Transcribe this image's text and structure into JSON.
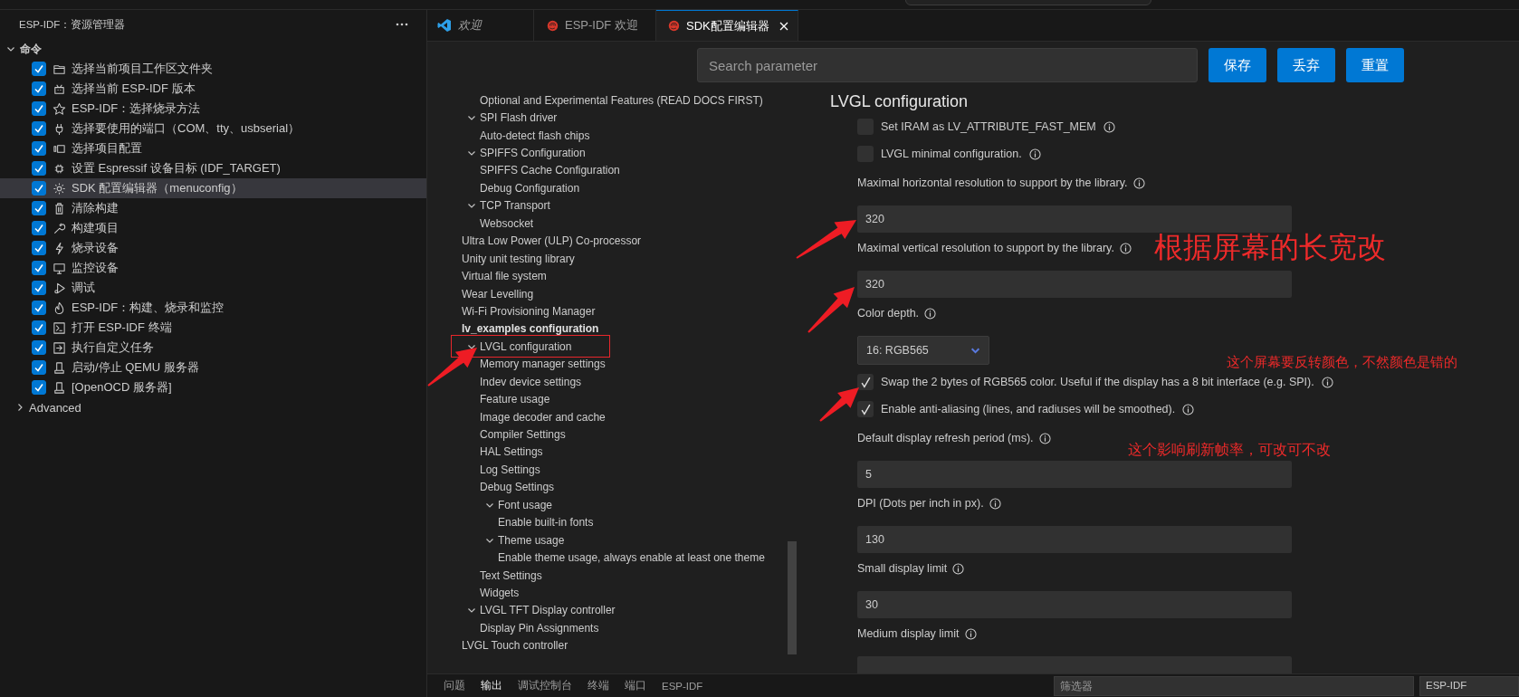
{
  "sidebar": {
    "title": "ESP-IDF：资源管理器",
    "section": {
      "label": "命令",
      "expanded": true
    },
    "commands": [
      {
        "label": "选择当前项目工作区文件夹",
        "checked": true,
        "selected": false
      },
      {
        "label": "选择当前 ESP-IDF 版本",
        "checked": true,
        "selected": false
      },
      {
        "label": "ESP-IDF：选择烧录方法",
        "checked": true,
        "selected": false
      },
      {
        "label": "选择要使用的端口（COM、tty、usbserial）",
        "checked": true,
        "selected": false
      },
      {
        "label": "选择项目配置",
        "checked": true,
        "selected": false
      },
      {
        "label": "设置 Espressif 设备目标 (IDF_TARGET)",
        "checked": true,
        "selected": false
      },
      {
        "label": "SDK 配置编辑器（menuconfig）",
        "checked": true,
        "selected": true
      },
      {
        "label": "清除构建",
        "checked": true,
        "selected": false
      },
      {
        "label": "构建项目",
        "checked": true,
        "selected": false
      },
      {
        "label": "烧录设备",
        "checked": true,
        "selected": false
      },
      {
        "label": "监控设备",
        "checked": true,
        "selected": false
      },
      {
        "label": "调试",
        "checked": true,
        "selected": false
      },
      {
        "label": "ESP-IDF：构建、烧录和监控",
        "checked": true,
        "selected": false
      },
      {
        "label": "打开 ESP-IDF 终端",
        "checked": true,
        "selected": false
      },
      {
        "label": "执行自定义任务",
        "checked": true,
        "selected": false
      },
      {
        "label": "启动/停止 QEMU 服务器",
        "checked": true,
        "selected": false
      },
      {
        "label": "[OpenOCD 服务器]",
        "checked": true,
        "selected": false
      }
    ],
    "advanced": {
      "label": "Advanced",
      "expanded": false
    }
  },
  "tabs": [
    {
      "label": "欢迎",
      "selected": false,
      "preview": true
    },
    {
      "label": "ESP-IDF 欢迎",
      "selected": false,
      "preview": false
    },
    {
      "label": "SDK配置编辑器",
      "selected": true,
      "preview": false
    }
  ],
  "editor": {
    "search": {
      "placeholder": "Search parameter"
    },
    "buttons": [
      "保存",
      "丢弃",
      "重置"
    ],
    "tree": [
      {
        "children": [
          {
            "label": "Optional and Experimental Features (READ DOCS FIRST)"
          }
        ]
      },
      {
        "label": "SPI Flash driver",
        "expanded": true,
        "children": [
          {
            "label": "Auto-detect flash chips"
          }
        ]
      },
      {
        "label": "SPIFFS Configuration",
        "expanded": true,
        "children": [
          {
            "label": "SPIFFS Cache Configuration"
          },
          {
            "label": "Debug Configuration"
          }
        ]
      },
      {
        "label": "TCP Transport",
        "expanded": true,
        "children": [
          {
            "label": "Websocket"
          }
        ]
      },
      {
        "label": "Ultra Low Power (ULP) Co-processor"
      },
      {
        "label": "Unity unit testing library"
      },
      {
        "label": "Virtual file system"
      },
      {
        "label": "Wear Levelling"
      },
      {
        "label": "Wi-Fi Provisioning Manager"
      },
      {
        "label": "lv_examples configuration",
        "bold": true
      },
      {
        "label": "LVGL configuration",
        "expanded": true,
        "children": [
          {
            "label": "Memory manager settings"
          },
          {
            "label": "Indev device settings"
          },
          {
            "label": "Feature usage"
          },
          {
            "label": "Image decoder and cache"
          },
          {
            "label": "Compiler Settings"
          },
          {
            "label": "HAL Settings"
          },
          {
            "label": "Log Settings"
          },
          {
            "label": "Debug Settings"
          },
          {
            "label": "Font usage",
            "expanded": true,
            "children": [
              {
                "label": "Enable built-in fonts"
              }
            ]
          },
          {
            "label": "Theme usage",
            "expanded": true,
            "children": [
              {
                "label": "Enable theme usage, always enable at least one theme"
              }
            ]
          },
          {
            "label": "Text Settings"
          },
          {
            "label": "Widgets"
          }
        ]
      },
      {
        "label": "LVGL TFT Display controller",
        "expanded": true,
        "children": [
          {
            "label": "Display Pin Assignments"
          }
        ]
      },
      {
        "label": "LVGL Touch controller"
      }
    ],
    "heading": "LVGL configuration",
    "settings": [
      {
        "kind": "checkbox",
        "label": "Set IRAM as LV_ATTRIBUTE_FAST_MEM",
        "checked": false
      },
      {
        "kind": "checkbox",
        "label": "LVGL minimal configuration.",
        "checked": false
      },
      {
        "kind": "number",
        "label": "Maximal horizontal resolution to support by the library.",
        "value": "320"
      },
      {
        "kind": "number",
        "label": "Maximal vertical resolution to support by the library.",
        "value": "320"
      },
      {
        "kind": "select",
        "label": "Color depth.",
        "value": "16: RGB565"
      },
      {
        "kind": "checkbox",
        "label": "Swap the 2 bytes of RGB565 color. Useful if the display has a 8 bit interface (e.g. SPI).",
        "checked": true
      },
      {
        "kind": "checkbox",
        "label": "Enable anti-aliasing (lines, and radiuses will be smoothed).",
        "checked": true
      },
      {
        "kind": "number",
        "label": "Default display refresh period (ms).",
        "value": "5"
      },
      {
        "kind": "number",
        "label": "DPI (Dots per inch in px).",
        "value": "130"
      },
      {
        "kind": "number",
        "label": "Small display limit",
        "value": "30"
      },
      {
        "kind": "number",
        "label": "Medium display limit"
      }
    ]
  },
  "panel": {
    "tabs": [
      {
        "label": "问题",
        "selected": false
      },
      {
        "label": "输出",
        "selected": true
      },
      {
        "label": "调试控制台",
        "selected": false
      },
      {
        "label": "终端",
        "selected": false
      },
      {
        "label": "端口",
        "selected": false
      },
      {
        "label": "ESP-IDF",
        "selected": false
      }
    ],
    "filter": {
      "placeholder": "筛选器"
    },
    "channel": "ESP-IDF"
  },
  "annotations": [
    "根据屏幕的长宽改",
    "这个屏幕要反转颜色，不然颜色是错的",
    "这个影响刷新帧率，可改可不改"
  ]
}
